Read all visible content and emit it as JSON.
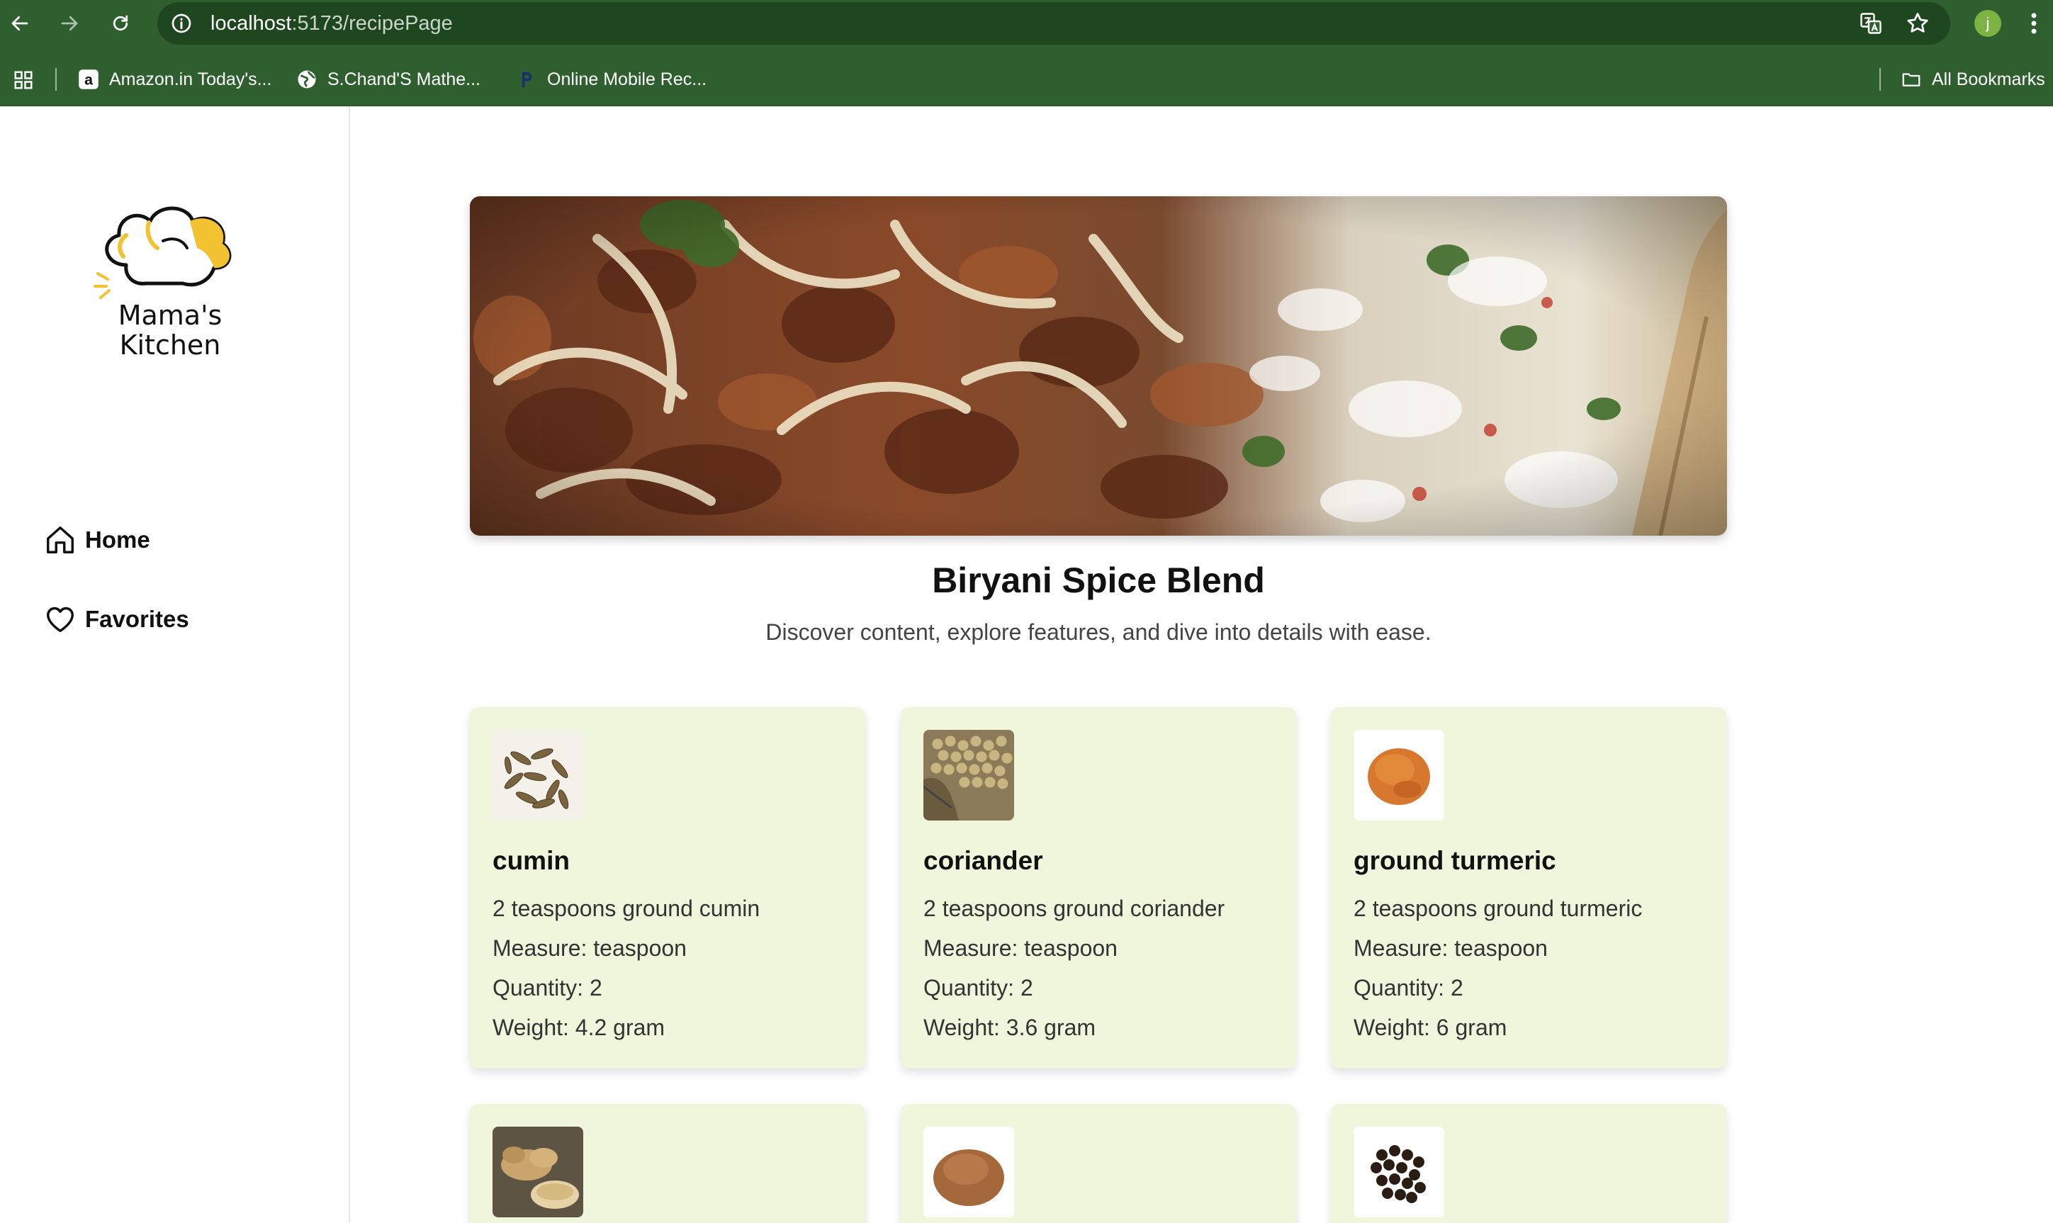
{
  "browser": {
    "url_host": "localhost",
    "url_path": ":5173/recipePage",
    "bookmarks": [
      {
        "label": "Amazon.in Today's...",
        "icon": "amazon-icon"
      },
      {
        "label": "S.Chand'S Mathe...",
        "icon": "globe-icon"
      },
      {
        "label": "Online Mobile Rec...",
        "icon": "paytm-icon"
      }
    ],
    "all_bookmarks": "All Bookmarks",
    "profile_initial": "j"
  },
  "sidebar": {
    "logo_text_line1": "Mama's",
    "logo_text_line2": "Kitchen",
    "items": [
      {
        "label": "Home",
        "icon": "home-icon"
      },
      {
        "label": "Favorites",
        "icon": "heart-icon"
      }
    ]
  },
  "recipe": {
    "title": "Biryani Spice Blend",
    "subtitle": "Discover content, explore features, and dive into details with ease."
  },
  "ingredients": [
    {
      "name": "cumin",
      "description": "2 teaspoons ground cumin",
      "measure": "Measure: teaspoon",
      "quantity": "Quantity: 2",
      "weight": "Weight: 4.2 gram",
      "image": "cumin-seeds"
    },
    {
      "name": "coriander",
      "description": "2 teaspoons ground coriander",
      "measure": "Measure: teaspoon",
      "quantity": "Quantity: 2",
      "weight": "Weight: 3.6 gram",
      "image": "coriander-seeds"
    },
    {
      "name": "ground turmeric",
      "description": "2 teaspoons ground turmeric",
      "measure": "Measure: teaspoon",
      "quantity": "Quantity: 2",
      "weight": "Weight: 6 gram",
      "image": "turmeric-powder"
    },
    {
      "image": "ginger"
    },
    {
      "image": "spice-powder"
    },
    {
      "image": "black-pepper"
    }
  ],
  "colors": {
    "browser_green": "#2f5f2f",
    "card_background": "#eff6dc",
    "logo_accent": "#f2c230"
  }
}
